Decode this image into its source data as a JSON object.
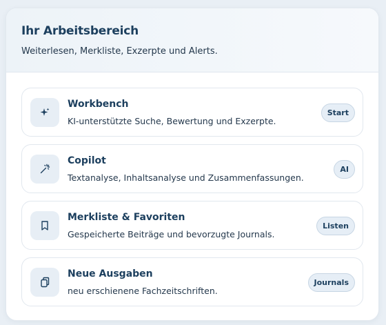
{
  "workspace": {
    "title": "Ihr Arbeitsbereich",
    "subtitle": "Weiterlesen, Merkliste, Exzerpte und Alerts."
  },
  "items": [
    {
      "title": "Workbench",
      "description": "KI-unterstützte Suche, Bewertung und Exzerpte.",
      "badge": "Start",
      "icon": "sparkles-icon"
    },
    {
      "title": "Copilot",
      "description": "Textanalyse, Inhaltsanalyse und Zusammenfassungen.",
      "badge": "AI",
      "icon": "magic-wand-icon"
    },
    {
      "title": "Merkliste & Favoriten",
      "description": "Gespeicherte Beiträge und bevorzugte Journals.",
      "badge": "Listen",
      "icon": "bookmark-icon"
    },
    {
      "title": "Neue Ausgaben",
      "description": "neu erschienene Fachzeitschriften.",
      "badge": "Journals",
      "icon": "copy-icon"
    }
  ],
  "colors": {
    "accent": "#1c3f5e",
    "badge_bg": "#e6eef6",
    "icon_bg": "#e7eef5"
  }
}
